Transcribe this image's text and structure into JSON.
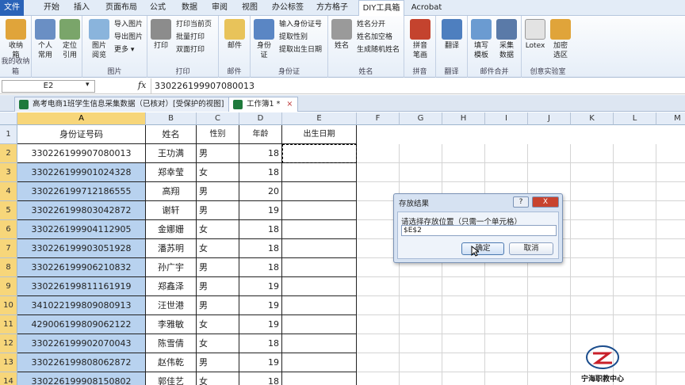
{
  "menu": {
    "tabs": [
      "文件",
      "开始",
      "插入",
      "页面布局",
      "公式",
      "数据",
      "审阅",
      "视图",
      "办公标签",
      "方方格子",
      "DIY工具箱",
      "Acrobat"
    ]
  },
  "ribbon": {
    "g1": {
      "label": "我的收纳箱",
      "btn": "收纳\n箱"
    },
    "g2": {
      "label": "",
      "btn1": "个人\n常用",
      "btn2": "定位\n引用"
    },
    "g3": {
      "label": "图片",
      "big": "图片\n阅览",
      "s1": "导入图片",
      "s2": "导出图片",
      "s3": "更多"
    },
    "g4": {
      "label": "打印",
      "big": "打印",
      "s1": "打印当前页",
      "s2": "批量打印",
      "s3": "双面打印"
    },
    "g5": {
      "label": "邮件",
      "big": "邮件"
    },
    "g6": {
      "label": "身份证",
      "big": "身份\n证",
      "s1": "输入身份证号",
      "s2": "提取性别",
      "s3": "提取出生日期"
    },
    "g7": {
      "label": "姓名",
      "big": "姓名",
      "s1": "姓名分开",
      "s2": "姓名加空格",
      "s3": "生成随机姓名"
    },
    "g8": {
      "label": "拼音",
      "big": "拼音\n笔画"
    },
    "g9": {
      "label": "翻译",
      "big": "翻译"
    },
    "g10": {
      "label": "邮件合并",
      "b1": "填写\n模板",
      "b2": "采集\n数据"
    },
    "g11": {
      "label": "创意实验室",
      "b1": "Lotex",
      "b2": "加密\n选区"
    }
  },
  "formula": {
    "namebox": "E2",
    "fx": "fx",
    "value": "330226199907080013"
  },
  "workbooks": [
    {
      "title": "高考电商1班学生信息采集数据（已核对）[受保护的视图]"
    },
    {
      "title": "工作簿1 *"
    }
  ],
  "columns": [
    "A",
    "B",
    "C",
    "D",
    "E",
    "F",
    "G",
    "H",
    "I",
    "J",
    "K",
    "L",
    "M"
  ],
  "headers": {
    "id": "身份证号码",
    "name": "姓名",
    "sex": "性别",
    "age": "年龄",
    "birth": "出生日期"
  },
  "rows": [
    {
      "n": "2",
      "id": "330226199907080013",
      "name": "王功满",
      "sex": "男",
      "age": "18"
    },
    {
      "n": "3",
      "id": "330226199901024328",
      "name": "郑幸莹",
      "sex": "女",
      "age": "18"
    },
    {
      "n": "4",
      "id": "330226199712186555",
      "name": "高翔",
      "sex": "男",
      "age": "20"
    },
    {
      "n": "5",
      "id": "330226199803042872",
      "name": "谢轩",
      "sex": "男",
      "age": "19"
    },
    {
      "n": "6",
      "id": "330226199904112905",
      "name": "金娜姗",
      "sex": "女",
      "age": "18"
    },
    {
      "n": "7",
      "id": "330226199903051928",
      "name": "潘苏明",
      "sex": "女",
      "age": "18"
    },
    {
      "n": "8",
      "id": "330226199906210832",
      "name": "孙广宇",
      "sex": "男",
      "age": "18"
    },
    {
      "n": "9",
      "id": "330226199811161919",
      "name": "郑鑫泽",
      "sex": "男",
      "age": "19"
    },
    {
      "n": "10",
      "id": "341022199809080913",
      "name": "汪世港",
      "sex": "男",
      "age": "19"
    },
    {
      "n": "11",
      "id": "429006199809062122",
      "name": "李雅敏",
      "sex": "女",
      "age": "19"
    },
    {
      "n": "12",
      "id": "330226199902070043",
      "name": "陈雪倩",
      "sex": "女",
      "age": "18"
    },
    {
      "n": "13",
      "id": "330226199808062872",
      "name": "赵伟乾",
      "sex": "男",
      "age": "19"
    },
    {
      "n": "14",
      "id": "330226199908150802",
      "name": "郭佳艺",
      "sex": "女",
      "age": "18"
    }
  ],
  "row1": "1",
  "dialog": {
    "title": "存放结果",
    "help": "?",
    "close": "X",
    "prompt": "请选择存放位置（只需一个单元格）",
    "value": "$E$2",
    "ok": "确定",
    "cancel": "取消"
  },
  "logo": {
    "text": "宁海职教中心"
  },
  "colors": {
    "selected": "#b8d2ef",
    "header_sel": "#f7d67a",
    "file_tab": "#2a63b8"
  }
}
